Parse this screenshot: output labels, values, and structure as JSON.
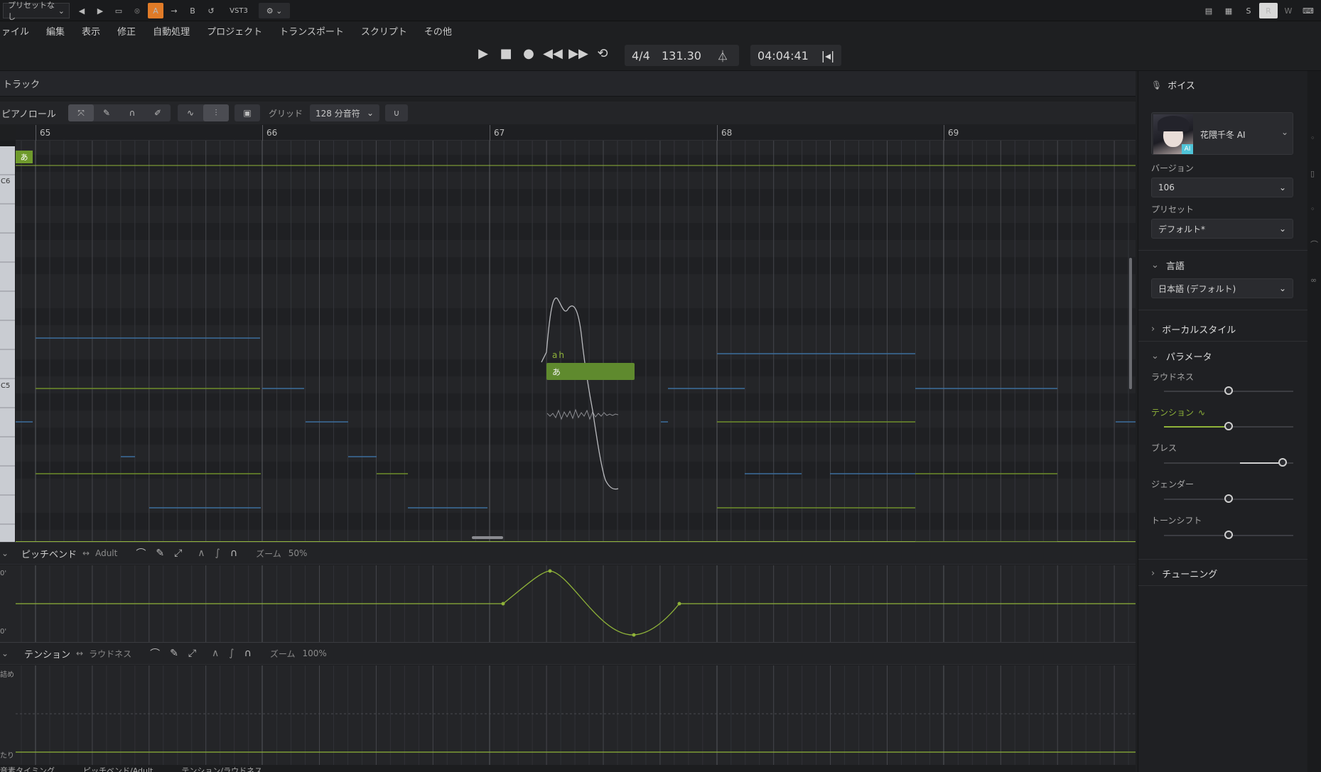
{
  "topbar": {
    "preset": "プリセットなし",
    "ab_a": "A",
    "ab_arrow": "→",
    "ab_b": "B",
    "format": "VST3",
    "right_buttons": [
      "S",
      "R",
      "W"
    ]
  },
  "menu": [
    "ァイル",
    "編集",
    "表示",
    "修正",
    "自動処理",
    "プロジェクト",
    "トランスポート",
    "スクリプト",
    "その他"
  ],
  "transport": {
    "time_signature": "4/4",
    "tempo": "131.30",
    "position": "04:04:41"
  },
  "track": {
    "title": "トラック"
  },
  "piano_roll": {
    "title": "ピアノロール",
    "grid_label": "グリッド",
    "grid_value": "128 分音符",
    "bars": [
      "65",
      "66",
      "67",
      "68",
      "69"
    ],
    "key_labels": [
      "C6",
      "C5"
    ],
    "marker_lyric": "あ",
    "note": {
      "lyric": "あ",
      "phoneme": "ah"
    }
  },
  "pitch_lane": {
    "label": "ピッチベンド",
    "linked": "Adult",
    "zoom_label": "ズーム",
    "zoom": "50%",
    "scale_top": "0'",
    "scale_bottom": "0'"
  },
  "tension_lane": {
    "label": "テンション",
    "linked": "ラウドネス",
    "zoom_label": "ズーム",
    "zoom": "100%",
    "scale_top": "詰め",
    "scale_bottom": "たり"
  },
  "bottom_tabs": [
    "音素タイミング",
    "ピッチベンド/Adult",
    "テンション/ラウドネス"
  ],
  "voice_panel": {
    "title": "ボイス",
    "voice_name": "花隈千冬 AI",
    "ai_badge": "AI",
    "version_label": "バージョン",
    "version": "106",
    "preset_label": "プリセット",
    "preset": "デフォルト*",
    "language_section": "言語",
    "language": "日本語 (デフォルト)",
    "vocal_style_section": "ボーカルスタイル",
    "parameters_section": "パラメータ",
    "params": [
      {
        "label": "ラウドネス",
        "value": 0.5
      },
      {
        "label": "テンション",
        "value": 0.5
      },
      {
        "label": "ブレス",
        "value": 0.92
      },
      {
        "label": "ジェンダー",
        "value": 0.5
      },
      {
        "label": "トーンシフト",
        "value": 0.5
      }
    ],
    "tuning_section": "チューニング"
  },
  "colors": {
    "accent_green": "#8fb339",
    "note_fill": "#5f8a2e",
    "ab_orange": "#e07b28",
    "blue_line": "#3d6e9e"
  }
}
